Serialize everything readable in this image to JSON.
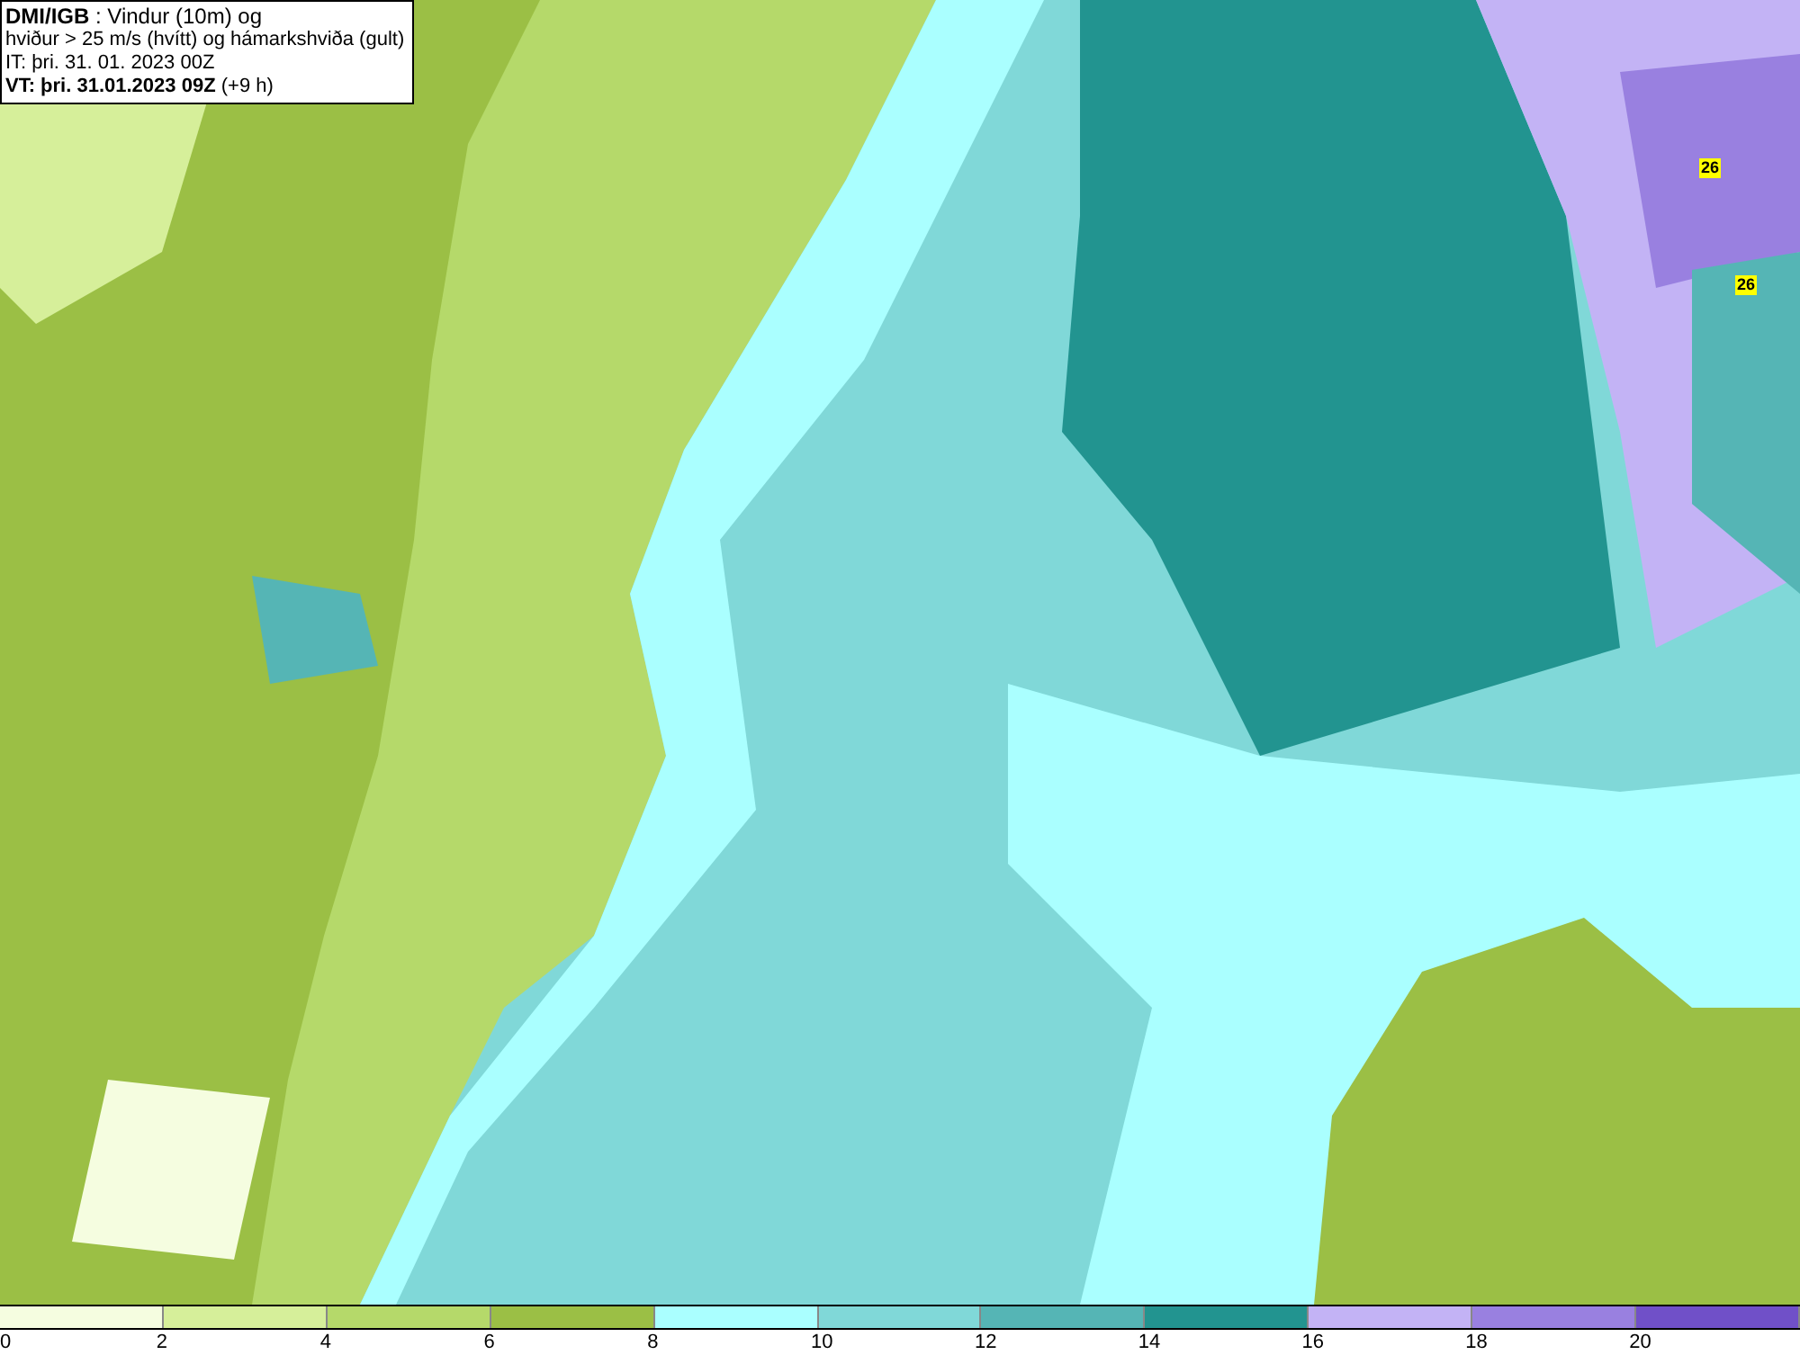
{
  "header": {
    "lines": [
      "**DMI/IGB** : Vindur (10m) og",
      "hviður > 25 m/s (hvítt) og hámarkshviða (gult)",
      "IT: þri. 31. 01. 2023 00Z",
      "**VT: þri. 31.01.2023 09Z** (+9 h)"
    ]
  },
  "map": {
    "gust_labels": [
      "26",
      "26"
    ]
  },
  "legend": {
    "swatches": [
      {
        "color": "#f5fde0"
      },
      {
        "color": "#d6ef9a"
      },
      {
        "color": "#b5d96a"
      },
      {
        "color": "#9bbf45"
      },
      {
        "color": "#aaffff"
      },
      {
        "color": "#80d8d8"
      },
      {
        "color": "#55b5b5"
      },
      {
        "color": "#229490"
      },
      {
        "color": "#c3b3f5"
      },
      {
        "color": "#9980e0"
      },
      {
        "color": "#7050c8"
      }
    ],
    "ticks": [
      "0",
      "2",
      "4",
      "6",
      "8",
      "10",
      "12",
      "14",
      "16",
      "18",
      "20"
    ]
  }
}
